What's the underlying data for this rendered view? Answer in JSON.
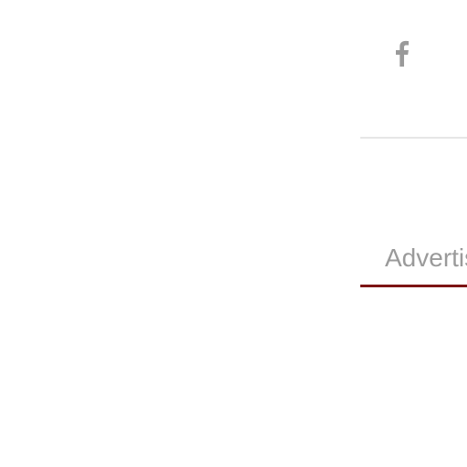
{
  "social": {
    "facebook_icon": "facebook-icon",
    "icon_color": "#9a9a9a"
  },
  "tabs": [
    {
      "label": "Advertise",
      "active": true
    }
  ],
  "colors": {
    "accent": "#7d1414",
    "divider": "#e6e6e6",
    "muted_text": "#9a9a9a"
  }
}
